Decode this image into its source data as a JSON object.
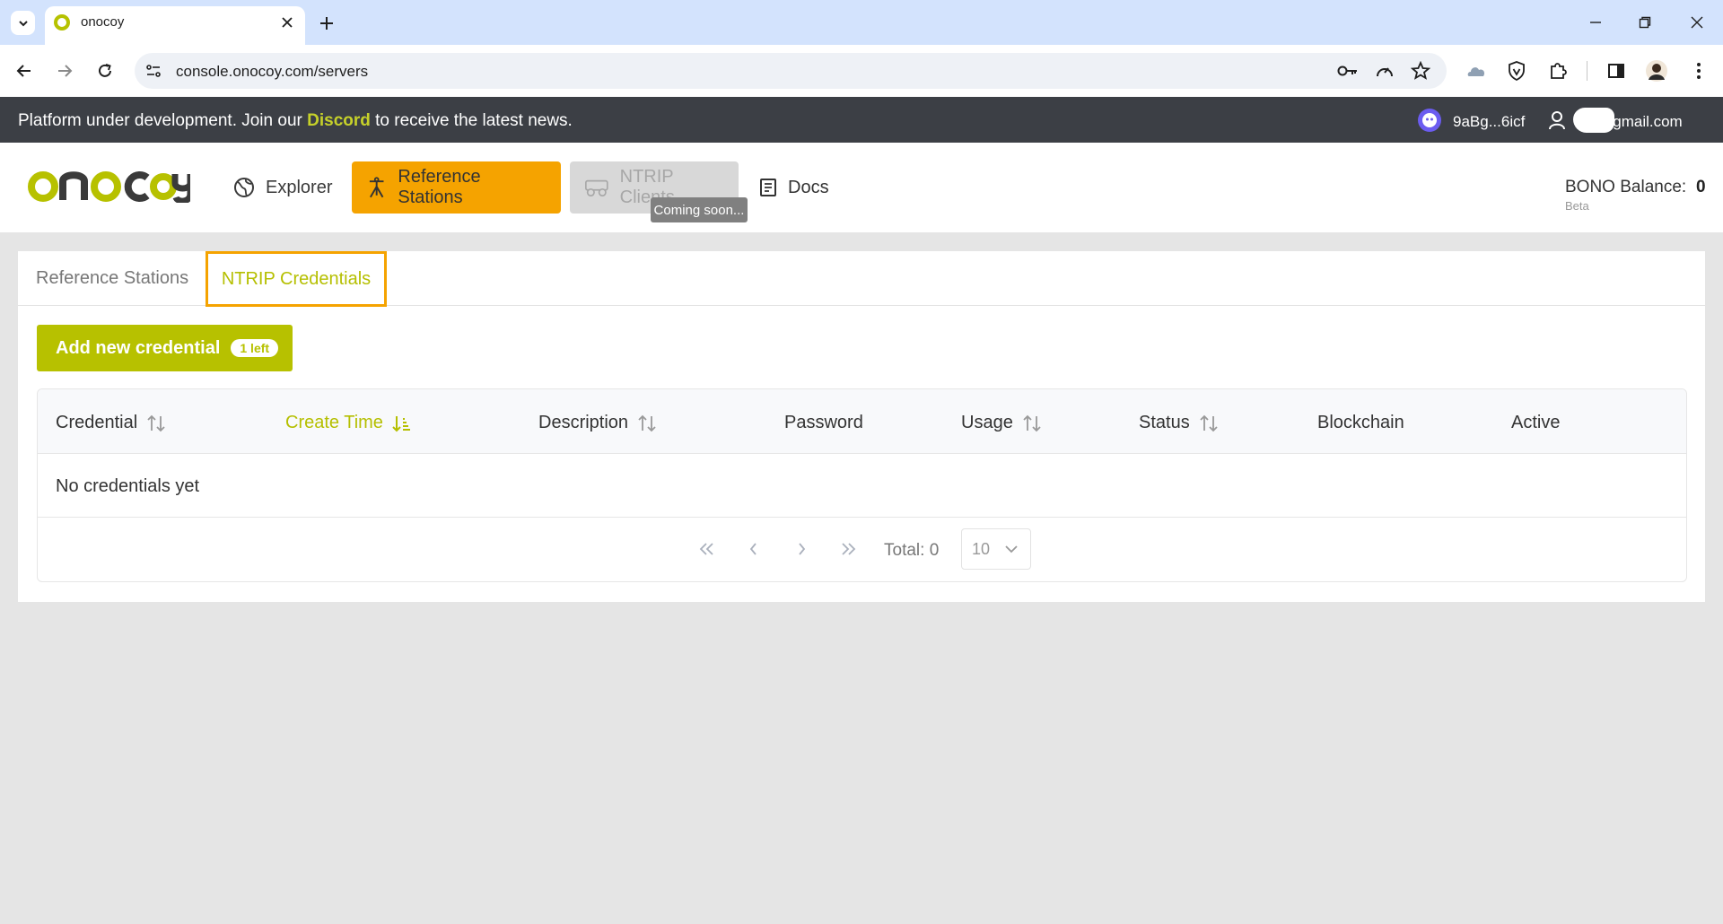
{
  "browser": {
    "tab_title": "onocoy",
    "url": "console.onocoy.com/servers"
  },
  "banner": {
    "text_before": "Platform under development. Join our ",
    "link": "Discord",
    "text_after": " to receive the latest news.",
    "wallet": "9aBg...6icf",
    "email": "@gmail.com"
  },
  "header": {
    "nav": {
      "explorer": "Explorer",
      "reference_stations": "Reference Stations",
      "ntrip_clients": "NTRIP Clients",
      "docs": "Docs"
    },
    "tooltip": "Coming soon...",
    "bono_label": "BONO Balance:",
    "bono_value": "0",
    "beta": "Beta"
  },
  "tabs": {
    "reference_stations": "Reference Stations",
    "ntrip_credentials": "NTRIP Credentials"
  },
  "actions": {
    "add_label": "Add new credential",
    "add_badge": "1 left"
  },
  "table": {
    "columns": [
      "Credential",
      "Create Time",
      "Description",
      "Password",
      "Usage",
      "Status",
      "Blockchain",
      "Active"
    ],
    "empty": "No credentials yet"
  },
  "pagination": {
    "total": "Total: 0",
    "page_size": "10"
  },
  "colors": {
    "accent_green": "#b7c100",
    "accent_orange": "#f5a300",
    "banner_bg": "#3c3f45"
  }
}
